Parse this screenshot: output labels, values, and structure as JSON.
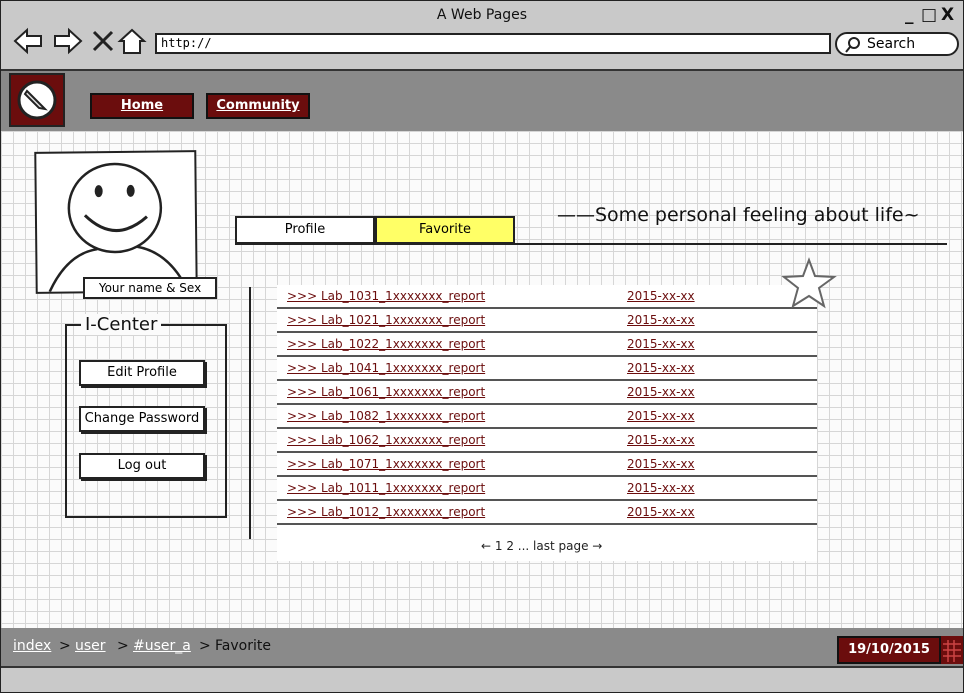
{
  "window": {
    "title": "A Web Pages",
    "controls": [
      "_",
      "□",
      "X"
    ]
  },
  "browser": {
    "url": "http://",
    "search_label": "Search",
    "icons": [
      "back-arrow-icon",
      "forward-arrow-icon",
      "close-x-icon",
      "home-icon",
      "search-icon"
    ]
  },
  "header": {
    "logo_icon": "pencil-logo-icon",
    "nav": [
      {
        "label": "Home"
      },
      {
        "label": "Community"
      }
    ]
  },
  "profile": {
    "avatar_icon": "smiley-face-icon",
    "name_tag": "Your name & Sex"
  },
  "icenter": {
    "title": "I-Center",
    "buttons": [
      {
        "label": "Edit Profile"
      },
      {
        "label": "Change Password"
      },
      {
        "label": "Log out"
      }
    ]
  },
  "tabs": [
    {
      "label": "Profile",
      "active": false
    },
    {
      "label": "Favorite",
      "active": true
    }
  ],
  "tagline": "——Some personal feeling about life~",
  "favorites": [
    {
      "title": ">>> Lab_1031_1xxxxxxx_report",
      "date": "2015-xx-xx"
    },
    {
      "title": ">>> Lab_1021_1xxxxxxx_report",
      "date": "2015-xx-xx"
    },
    {
      "title": ">>> Lab_1022_1xxxxxxx_report",
      "date": "2015-xx-xx"
    },
    {
      "title": ">>> Lab_1041_1xxxxxxx_report",
      "date": "2015-xx-xx"
    },
    {
      "title": ">>> Lab_1061_1xxxxxxx_report",
      "date": "2015-xx-xx"
    },
    {
      "title": ">>> Lab_1082_1xxxxxxx_report",
      "date": "2015-xx-xx"
    },
    {
      "title": ">>> Lab_1062_1xxxxxxx_report",
      "date": "2015-xx-xx"
    },
    {
      "title": ">>> Lab_1071_1xxxxxxx_report",
      "date": "2015-xx-xx"
    },
    {
      "title": ">>> Lab_1011_1xxxxxxx_report",
      "date": "2015-xx-xx"
    },
    {
      "title": ">>> Lab_1012_1xxxxxxx_report",
      "date": "2015-xx-xx"
    }
  ],
  "pager": "← 1 2 ... last page →",
  "breadcrumb": {
    "items": [
      "index",
      "user",
      "#user_a"
    ],
    "current": "Favorite",
    "separator": ">"
  },
  "date": "19/10/2015",
  "colors": {
    "accent": "#6b0d0d",
    "highlight": "#ffff66",
    "header_bg": "#8a8a8a"
  }
}
